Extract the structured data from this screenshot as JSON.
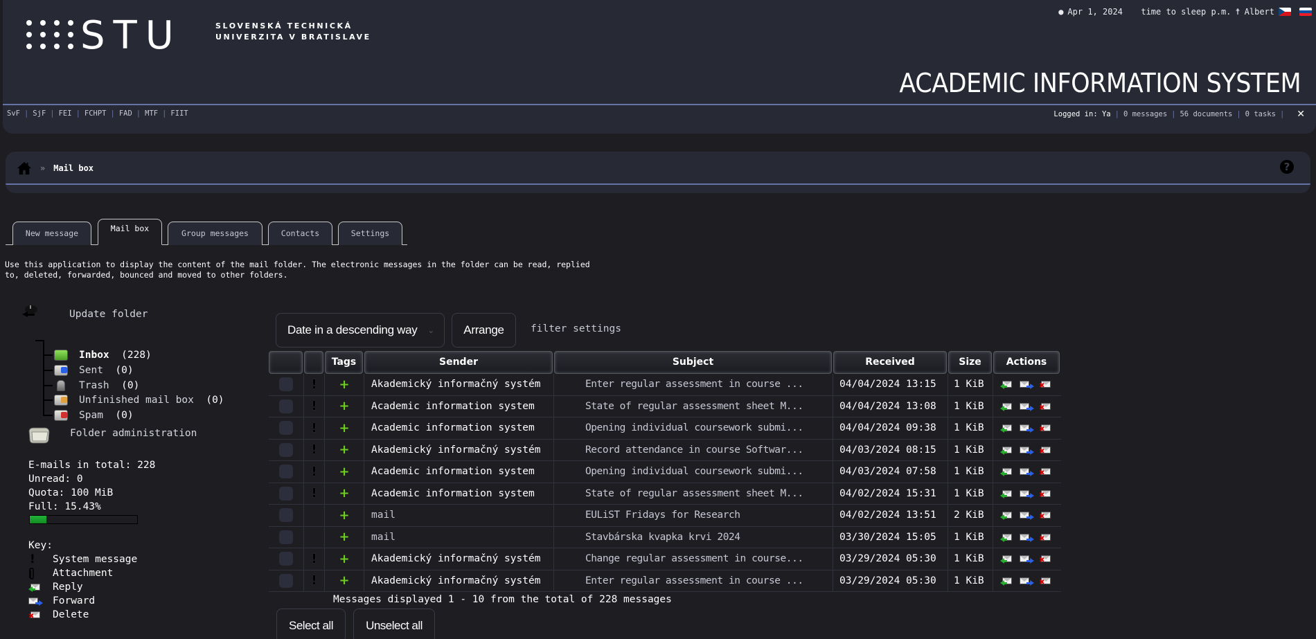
{
  "header": {
    "logo_text": "STU",
    "university_line1": "SLOVENSKÁ TECHNICKÁ",
    "university_line2": "UNIVERZITA V BRATISLAVE",
    "date": "Apr 1, 2024",
    "time_text": "time to sleep p.m.",
    "user_name": "Albert",
    "app_title": "ACADEMIC INFORMATION SYSTEM",
    "faculties": [
      "SvF",
      "SjF",
      "FEI",
      "FCHPT",
      "FAD",
      "MTF",
      "FIIT"
    ],
    "logged_in_label": "Logged in: Ya",
    "messages_link": "0 messages",
    "documents_link": "56 documents",
    "tasks_link": "0 tasks",
    "close_label": "✕"
  },
  "breadcrumb": {
    "separator": "»",
    "current": "Mail box",
    "help_label": "?"
  },
  "tabs": [
    {
      "label": "New message",
      "active": false
    },
    {
      "label": "Mail box",
      "active": true
    },
    {
      "label": "Group messages",
      "active": false
    },
    {
      "label": "Contacts",
      "active": false
    },
    {
      "label": "Settings",
      "active": false
    }
  ],
  "intro_text": "Use this application to display the content of the mail folder. The electronic messages in the folder can be read, replied to, deleted, forwarded, bounced and moved to other folders.",
  "sidebar": {
    "update_folder": "Update folder",
    "folders": [
      {
        "name": "Inbox",
        "count": "(228)",
        "icon": "inbox-icon",
        "color": "#6fc23a",
        "bold": true
      },
      {
        "name": "Sent",
        "count": "(0)",
        "icon": "sent-icon",
        "color": "#2a5fe8",
        "bold": false
      },
      {
        "name": "Trash",
        "count": "(0)",
        "icon": "trash-icon",
        "color": "#9a9a9a",
        "bold": false
      },
      {
        "name": "Unfinished mail box",
        "count": "(0)",
        "icon": "drafts-icon",
        "color": "#e0a040",
        "bold": false
      },
      {
        "name": "Spam",
        "count": "(0)",
        "icon": "spam-icon",
        "color": "#d03030",
        "bold": false
      }
    ],
    "folder_admin": "Folder administration",
    "stats": {
      "total": "E-mails in total: 228",
      "unread": "Unread: 0",
      "quota": "Quota: 100 MiB",
      "full": "Full: 15.43%",
      "full_percent": 15.43
    },
    "key": {
      "title": "Key:",
      "items": [
        {
          "icon": "system-message-icon",
          "label": "System message"
        },
        {
          "icon": "attachment-icon",
          "label": "Attachment"
        },
        {
          "icon": "reply-icon",
          "label": "Reply"
        },
        {
          "icon": "forward-icon",
          "label": "Forward"
        },
        {
          "icon": "delete-icon",
          "label": "Delete"
        }
      ]
    }
  },
  "controls": {
    "sort_selected": "Date in a descending way",
    "arrange_label": "Arrange",
    "filter_label": "filter settings"
  },
  "table": {
    "columns": [
      "",
      "",
      "Tags",
      "Sender",
      "Subject",
      "Received",
      "Size",
      "Actions"
    ],
    "rows": [
      {
        "system": true,
        "sender": "Akademický informačný systém",
        "subject": "Enter regular assessment in course ...",
        "received": "04/04/2024 13:15",
        "size": "1 KiB"
      },
      {
        "system": true,
        "sender": "Academic information system",
        "subject": "State of regular assessment sheet M...",
        "received": "04/04/2024 13:08",
        "size": "1 KiB"
      },
      {
        "system": true,
        "sender": "Academic information system",
        "subject": "Opening individual coursework submi...",
        "received": "04/04/2024 09:38",
        "size": "1 KiB"
      },
      {
        "system": true,
        "sender": "Akademický informačný systém",
        "subject": "Record attendance in course Softwar...",
        "received": "04/03/2024 08:15",
        "size": "1 KiB"
      },
      {
        "system": true,
        "sender": "Academic information system",
        "subject": "Opening individual coursework submi...",
        "received": "04/03/2024 07:58",
        "size": "1 KiB"
      },
      {
        "system": true,
        "sender": "Academic information system",
        "subject": "State of regular assessment sheet M...",
        "received": "04/02/2024 15:31",
        "size": "1 KiB"
      },
      {
        "system": false,
        "sender": "mail",
        "subject": "EULiST Fridays for Research",
        "received": "04/02/2024 13:51",
        "size": "2 KiB"
      },
      {
        "system": false,
        "sender": "mail",
        "subject": "Stavbárska kvapka krvi 2024",
        "received": "03/30/2024 15:05",
        "size": "1 KiB"
      },
      {
        "system": true,
        "sender": "Akademický informačný systém",
        "subject": "Change regular assessment in course...",
        "received": "03/29/2024 05:30",
        "size": "1 KiB"
      },
      {
        "system": true,
        "sender": "Akademický informačný systém",
        "subject": "Enter regular assessment in course ...",
        "received": "03/29/2024 05:30",
        "size": "1 KiB"
      }
    ],
    "system_mark": "!",
    "tag_mark": "+"
  },
  "footer": {
    "message_count": "Messages displayed 1 - 10 from the total of 228 messages",
    "select_all": "Select all",
    "unselect_all": "Unselect all"
  }
}
